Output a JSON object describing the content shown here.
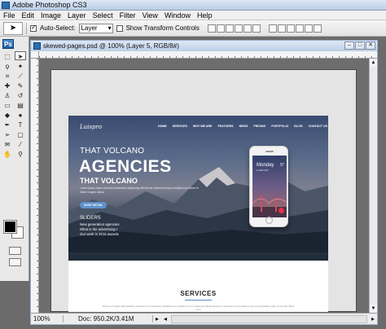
{
  "app": {
    "window_title": "Adobe Photoshop CS3",
    "ps_badge": "Ps"
  },
  "menu": [
    "File",
    "Edit",
    "Image",
    "Layer",
    "Select",
    "Filter",
    "View",
    "Window",
    "Help"
  ],
  "options": {
    "auto_select_label": "Auto-Select:",
    "auto_select_checked": true,
    "auto_select_value": "Layer",
    "show_transform_label": "Show Transform Controls",
    "show_transform_checked": false
  },
  "document": {
    "title": "skewed-pages.psd @ 100% (Layer 5, RGB/8#)",
    "zoom": "100%",
    "doc_info": "Doc: 950.2K/3.41M"
  },
  "colors": {
    "foreground": "#000000",
    "background": "#ffffff"
  },
  "site": {
    "logo": "Luispro",
    "nav": [
      "HOME",
      "SERVICES",
      "WHY WE ARE",
      "FEATURES",
      "NEWS",
      "PRICING",
      "PORTFOLIO",
      "BLOG",
      "CONTACT US"
    ],
    "hero_pre": "THAT VOLCANO",
    "hero_head": "AGENCIES",
    "hero_sub": "THAT VOLCANO",
    "hero_desc": "Lorem ipsum dolor sit amet consectetur adipiscing elit sed do eiusmod tempor incididunt ut labore et dolore magna aliqua",
    "hero_button": "SHOP DETAIL",
    "sliders_label": "SLIDERS",
    "slider_lines": [
      "New generation agencies",
      "What is the advertising t",
      "Our work in 2016 awards"
    ],
    "phone": {
      "day": "Monday",
      "temp": "5°",
      "date": "14 SEP 2016"
    },
    "services_heading": "SERVICES",
    "services_desc": "Dolore eu fugiat nulla pariatur excepteur sint occaecat cupidatat non proident sunt in culpa qui officia deserunt mollit anim id est laborum sed ut perspiciatis unde omnis iste natus error"
  }
}
